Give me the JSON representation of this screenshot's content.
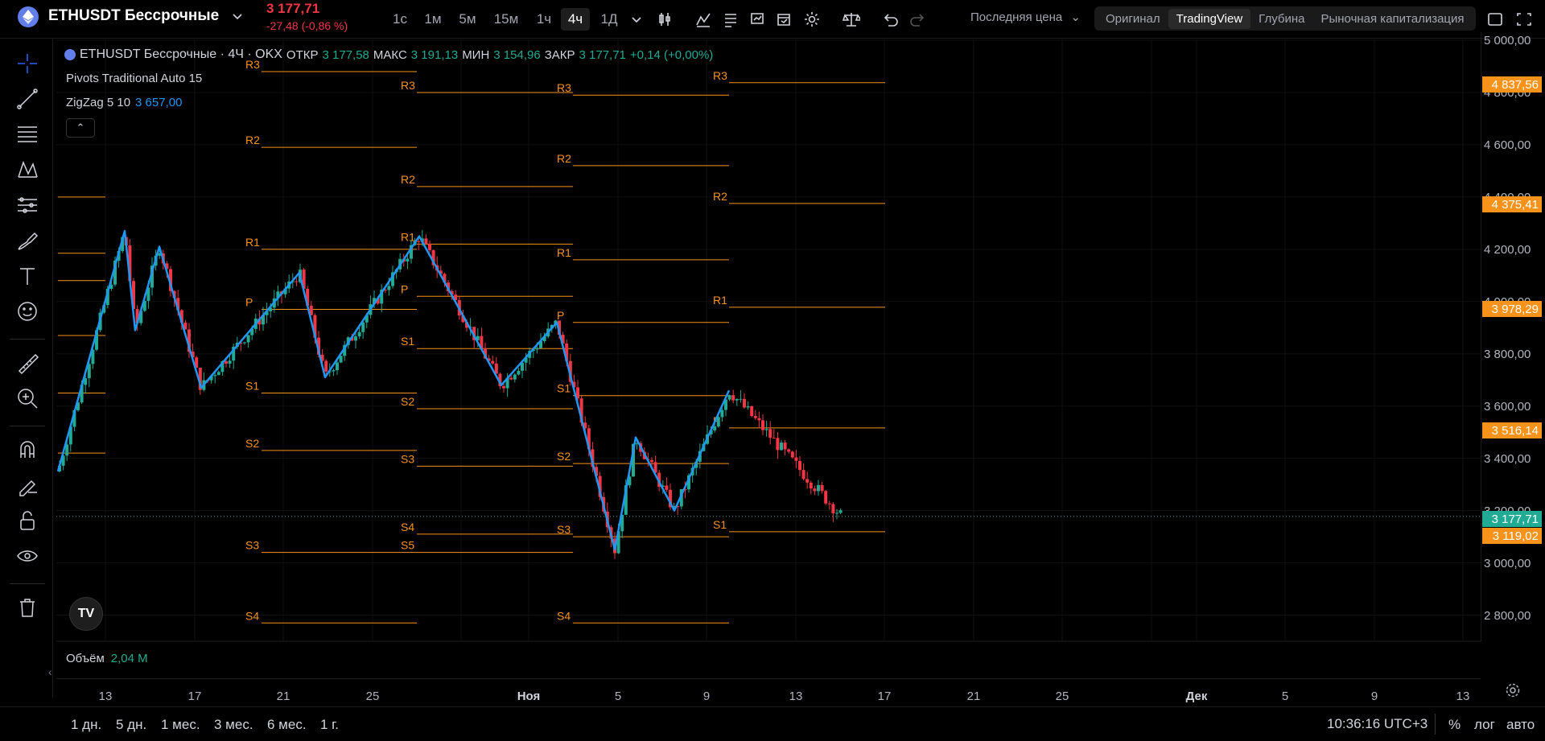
{
  "symbol": {
    "name": "ETHUSDT Бессрочные",
    "price": "3 177,71",
    "change": "-27,48 (-0,86 %)"
  },
  "timeframes": [
    "1с",
    "1м",
    "5м",
    "15м",
    "1ч",
    "4ч",
    "1Д"
  ],
  "active_timeframe": "4ч",
  "price_source": "Последняя цена",
  "chart_modes": [
    "Оригинал",
    "TradingView",
    "Глубина",
    "Рыночная капитализация"
  ],
  "active_mode": "TradingView",
  "legend": {
    "title": "ETHUSDT Бессрочные · 4Ч · OKX",
    "open_label": "ОТКР",
    "open": "3 177,58",
    "high_label": "МАКС",
    "high": "3 191,13",
    "low_label": "МИН",
    "low": "3 154,96",
    "close_label": "ЗАКР",
    "close": "3 177,71",
    "change": "+0,14 (+0,00%)",
    "indicator1": "Pivots Traditional Auto 15",
    "indicator2": "ZigZag 5 10",
    "indicator2_value": "3 657,00"
  },
  "volume": {
    "label": "Объём",
    "value": "2,04 M"
  },
  "price_axis": {
    "labels": [
      "5 000,00",
      "4 800,00",
      "4 600,00",
      "4 400,00",
      "4 200,00",
      "4 000,00",
      "3 800,00",
      "3 600,00",
      "3 400,00",
      "3 200,00",
      "3 000,00",
      "2 800,00"
    ],
    "tags": [
      {
        "text": "4 837,56",
        "color": "#f7931a"
      },
      {
        "text": "4 375,41",
        "color": "#f7931a"
      },
      {
        "text": "3 978,29",
        "color": "#f7931a"
      },
      {
        "text": "3 516,14",
        "color": "#f7931a"
      },
      {
        "text": "3 177,71",
        "color": "#22ab94"
      },
      {
        "text": "3 119,02",
        "color": "#f7931a"
      }
    ]
  },
  "time_axis": {
    "labels": [
      "13",
      "17",
      "21",
      "25",
      "Ноя",
      "5",
      "9",
      "13",
      "17",
      "21",
      "25",
      "Дек",
      "5",
      "9",
      "13"
    ]
  },
  "ranges": [
    "1 дн.",
    "5 дн.",
    "1 мес.",
    "3 мес.",
    "6 мес.",
    "1 г."
  ],
  "clock": "10:36:16 UTC+3",
  "scale_options": [
    "%",
    "лог",
    "авто"
  ],
  "chart_data": {
    "type": "candlestick",
    "ylim": [
      2700,
      5000
    ],
    "pivot_levels": [
      {
        "period": 1,
        "P": 4080,
        "R1": 4185,
        "R2": 4400,
        "S1": 3870,
        "S2": 3650,
        "S3": 3420
      },
      {
        "period": 2,
        "P": 3970,
        "R1": 4200,
        "R2": 4590,
        "R3": 4880,
        "S1": 3650,
        "S2": 3430,
        "S3": 3040,
        "S4": 2770
      },
      {
        "period": 3,
        "P": 4020,
        "R1": 4220,
        "R2": 4440,
        "R3": 4800,
        "S1": 3820,
        "S2": 3590,
        "S3": 3370,
        "S4": 3110,
        "S5": 3040
      },
      {
        "period": 4,
        "P": 3920,
        "R1": 4160,
        "R2": 4520,
        "R3": 4790,
        "S1": 3640,
        "S2": 3380,
        "S3": 3100,
        "S4": 2770
      },
      {
        "period": 5,
        "P": 3516.14,
        "R1": 3978.29,
        "R2": 4375.41,
        "R3": 4837.56,
        "S1": 3119.02
      }
    ],
    "zigzag": [
      3350,
      4270,
      3890,
      4210,
      3670,
      4110,
      3710,
      4250,
      3680,
      3920,
      3050,
      3480,
      3200,
      3660
    ],
    "last_close": 3177.71
  }
}
